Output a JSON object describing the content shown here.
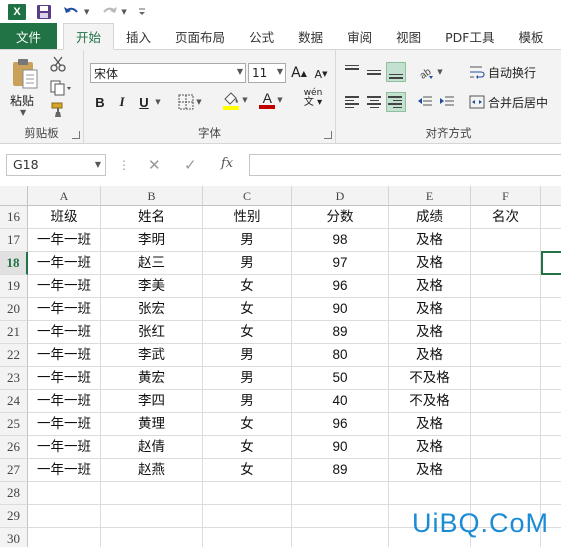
{
  "app": {
    "logo_text": "X",
    "accent": "#217346",
    "quick_access": [
      {
        "icon": "save-icon"
      },
      {
        "icon": "undo-icon"
      },
      {
        "icon": "redo-icon"
      },
      {
        "icon": "customize-qat-icon"
      }
    ]
  },
  "tabs": [
    {
      "label": "文件",
      "kind": "file"
    },
    {
      "label": "开始",
      "kind": "active"
    },
    {
      "label": "插入"
    },
    {
      "label": "页面布局"
    },
    {
      "label": "公式"
    },
    {
      "label": "数据"
    },
    {
      "label": "审阅"
    },
    {
      "label": "视图"
    },
    {
      "label": "PDF工具"
    },
    {
      "label": "模板"
    }
  ],
  "ribbon": {
    "clipboard": {
      "group_label": "剪贴板",
      "paste_label": "粘贴"
    },
    "font": {
      "group_label": "字体",
      "font_name": "宋体",
      "font_size": "11",
      "bold": "B",
      "italic": "I",
      "underline": "U",
      "grow": "A",
      "shrink": "A",
      "font_color_glyph": "A",
      "pinyin_glyph": "wén",
      "fill_color": "#ffff00",
      "font_color": "#c00000"
    },
    "alignment": {
      "group_label": "对齐方式",
      "wrap_text": "自动换行",
      "merge_center": "合并后居中"
    }
  },
  "formula_bar": {
    "name_box": "G18",
    "fx_label": "fx",
    "value": ""
  },
  "sheet": {
    "columns": [
      "A",
      "B",
      "C",
      "D",
      "E",
      "F"
    ],
    "selected_cell": "G18",
    "rows": [
      {
        "num": "16",
        "cells": [
          "班级",
          "姓名",
          "性别",
          "分数",
          "成绩",
          "名次"
        ]
      },
      {
        "num": "17",
        "cells": [
          "一年一班",
          "李明",
          "男",
          "98",
          "及格",
          ""
        ]
      },
      {
        "num": "18",
        "cells": [
          "一年一班",
          "赵三",
          "男",
          "97",
          "及格",
          ""
        ]
      },
      {
        "num": "19",
        "cells": [
          "一年一班",
          "李美",
          "女",
          "96",
          "及格",
          ""
        ]
      },
      {
        "num": "20",
        "cells": [
          "一年一班",
          "张宏",
          "女",
          "90",
          "及格",
          ""
        ]
      },
      {
        "num": "21",
        "cells": [
          "一年一班",
          "张红",
          "女",
          "89",
          "及格",
          ""
        ]
      },
      {
        "num": "22",
        "cells": [
          "一年一班",
          "李武",
          "男",
          "80",
          "及格",
          ""
        ]
      },
      {
        "num": "23",
        "cells": [
          "一年一班",
          "黄宏",
          "男",
          "50",
          "不及格",
          ""
        ]
      },
      {
        "num": "24",
        "cells": [
          "一年一班",
          "李四",
          "男",
          "40",
          "不及格",
          ""
        ]
      },
      {
        "num": "25",
        "cells": [
          "一年一班",
          "黄理",
          "女",
          "96",
          "及格",
          ""
        ]
      },
      {
        "num": "26",
        "cells": [
          "一年一班",
          "赵倩",
          "女",
          "90",
          "及格",
          ""
        ]
      },
      {
        "num": "27",
        "cells": [
          "一年一班",
          "赵燕",
          "女",
          "89",
          "及格",
          ""
        ]
      },
      {
        "num": "28",
        "cells": [
          "",
          "",
          "",
          "",
          "",
          ""
        ]
      },
      {
        "num": "29",
        "cells": [
          "",
          "",
          "",
          "",
          "",
          ""
        ]
      },
      {
        "num": "30",
        "cells": [
          "",
          "",
          "",
          "",
          "",
          ""
        ]
      },
      {
        "num": "31",
        "cells": [
          "",
          "",
          "",
          "",
          "",
          ""
        ]
      }
    ]
  },
  "watermark": "UiBQ.CoM"
}
